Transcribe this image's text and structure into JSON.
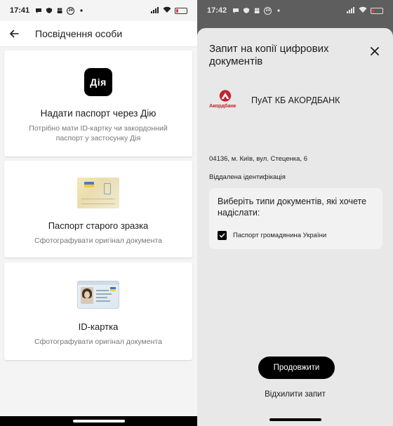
{
  "left_screen": {
    "status": {
      "time": "17:41",
      "badge": "24"
    },
    "header": {
      "title": "Посвідчення особи"
    },
    "options": [
      {
        "title": "Надати паспорт через Дію",
        "subtitle": "Потрібно мати ID-картку чи закордонний паспорт у застосунку Дія",
        "logo_text": "Дія"
      },
      {
        "title": "Паспорт старого зразка",
        "subtitle": "Сфотографувати оригінал документа"
      },
      {
        "title": "ID-картка",
        "subtitle": "Сфотографувати оригінал документа"
      }
    ]
  },
  "right_screen": {
    "status": {
      "time": "17:42",
      "badge": "24"
    },
    "sheet": {
      "title": "Запит на копії цифрових документів",
      "bank_logo_text": "Акордбанк",
      "bank_name": "ПуАТ  КБ АКОРДБАНК",
      "address": "04136, м. Київ, вул. Стеценка,  6",
      "remote_id": "Віддалена ідентифікація",
      "question": "Виберіть типи документів, які хочете надіслати:",
      "document_option": {
        "label": "Паспорт громадянина України",
        "checked": true
      },
      "continue_label": "Продовжити",
      "reject_label": "Відхилити запит"
    }
  },
  "colors": {
    "bank_red": "#c0262f",
    "battery_red": "#e4383f",
    "sheet_bg": "#e8e8e8"
  }
}
